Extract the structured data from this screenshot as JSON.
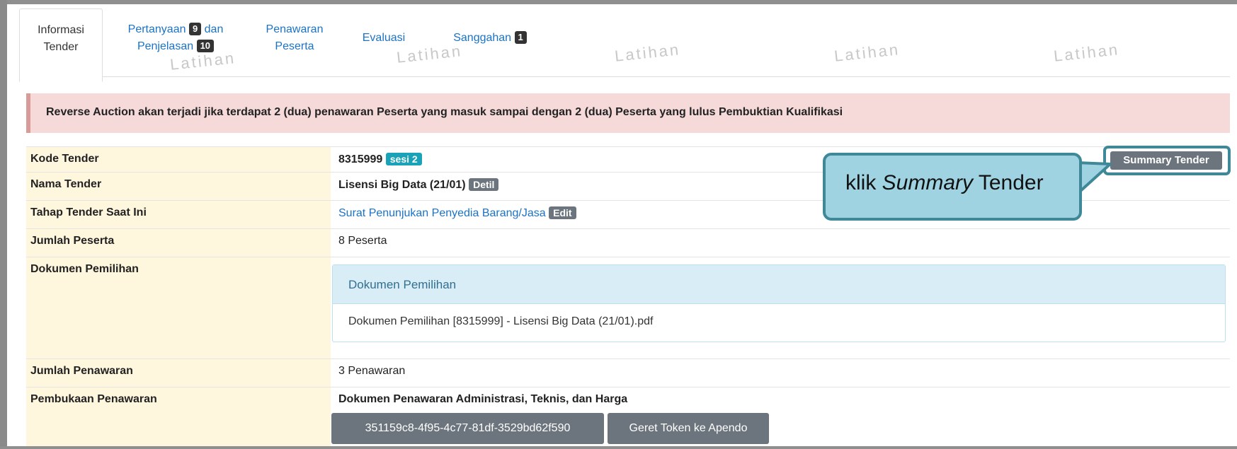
{
  "tabs": {
    "informasi_l1": "Informasi",
    "informasi_l2": "Tender",
    "pertanyaan_l1": "Pertanyaan",
    "pertanyaan_count": "9",
    "pertanyaan_dan": "dan",
    "penjelasan_l2": "Penjelasan",
    "penjelasan_count": "10",
    "penawaran_l1": "Penawaran",
    "penawaran_l2": "Peserta",
    "evaluasi": "Evaluasi",
    "sanggahan": "Sanggahan",
    "sanggahan_count": "1"
  },
  "watermark": "Latihan",
  "alert": "Reverse Auction akan terjadi jika terdapat 2 (dua) penawaran Peserta yang masuk sampai dengan 2 (dua) Peserta yang lulus Pembuktian Kualifikasi",
  "summary_button": "Summary Tender",
  "callout": {
    "prefix": "klik ",
    "italic": "Summary",
    "suffix": " Tender"
  },
  "rows": {
    "kode": {
      "label": "Kode Tender",
      "value": "8315999",
      "badge": "sesi 2"
    },
    "nama": {
      "label": "Nama Tender",
      "value": "Lisensi Big Data (21/01)",
      "badge": "Detil"
    },
    "tahap": {
      "label": "Tahap Tender Saat Ini",
      "value": "Surat Penunjukan Penyedia Barang/Jasa",
      "badge": "Edit"
    },
    "jumlah_peserta": {
      "label": "Jumlah Peserta",
      "value": "8 Peserta"
    },
    "dokumen": {
      "label": "Dokumen Pemilihan",
      "panel_title": "Dokumen Pemilihan",
      "file": "Dokumen Pemilihan [8315999] - Lisensi Big Data (21/01).pdf"
    },
    "jumlah_penawaran": {
      "label": "Jumlah Penawaran",
      "value": "3 Penawaran"
    },
    "pembukaan": {
      "label": "Pembukaan Penawaran",
      "value": "Dokumen Penawaran Administrasi, Teknis, dan Harga",
      "token": "351159c8-4f95-4c77-81df-3529bd62f590",
      "apendo_button": "Geret Token ke Apendo"
    }
  },
  "colors": {
    "accent": "#1a73c8",
    "callout_fill": "#9fd3e2",
    "callout_border": "#3f8898",
    "label_bg": "#fff6de"
  }
}
